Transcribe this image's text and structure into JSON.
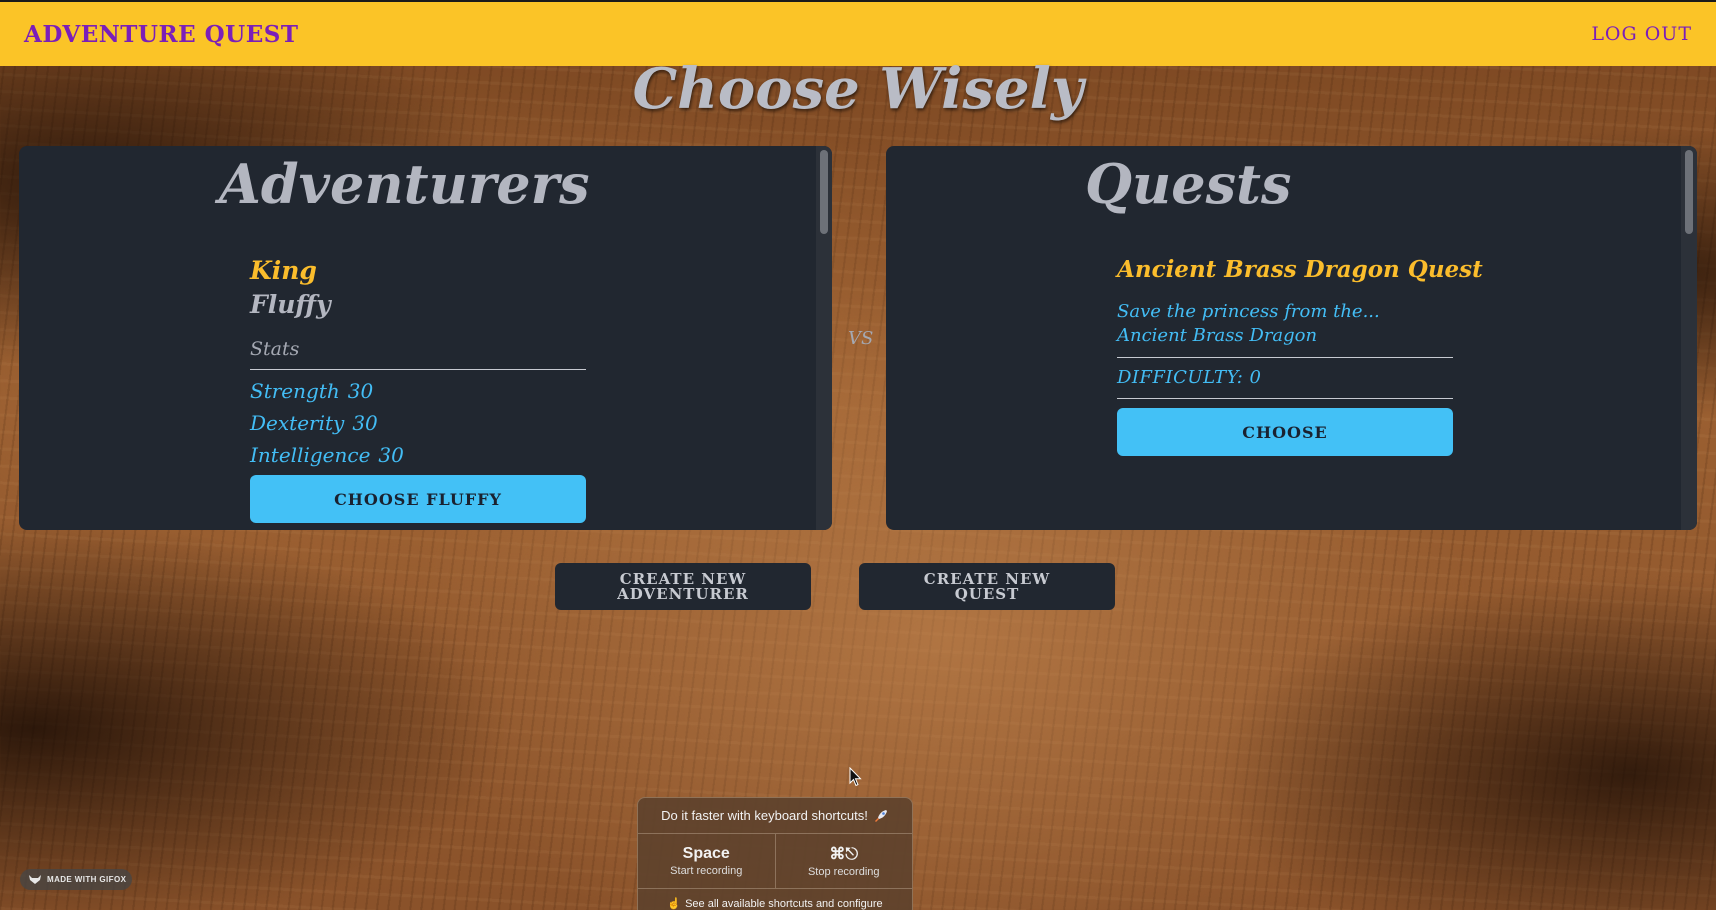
{
  "header": {
    "brand": "ADVENTURE QUEST",
    "logout_label": "LOG OUT"
  },
  "page": {
    "title": "Choose Wisely",
    "vs_label": "VS"
  },
  "adventurers": {
    "title": "Adventurers",
    "items": [
      {
        "class": "King",
        "name": "Fluffy",
        "stats_label": "Stats",
        "stats": [
          {
            "label": "Strength",
            "value": "30"
          },
          {
            "label": "Dexterity",
            "value": "30"
          },
          {
            "label": "Intelligence",
            "value": "30"
          }
        ],
        "button_label": "CHOOSE FLUFFY"
      }
    ]
  },
  "quests": {
    "title": "Quests",
    "items": [
      {
        "title": "Ancient Brass Dragon Quest",
        "description": "Save the princess from the... Ancient Brass Dragon",
        "difficulty": "DIFFICULTY: 0",
        "button_label": "CHOOSE"
      }
    ]
  },
  "actions": {
    "create_adventurer": "CREATE NEW ADVENTURER",
    "create_quest": "CREATE NEW QUEST"
  },
  "gifox": {
    "badge_text": "MADE WITH GIFOX",
    "popup": {
      "header": "Do it faster with keyboard shortcuts!",
      "shortcuts": [
        {
          "key": "Space",
          "action": "Start recording"
        },
        {
          "key": "⌘⎋",
          "action": "Stop recording"
        }
      ],
      "footer": "See all available shortcuts and configure"
    }
  },
  "colors": {
    "header_bg": "#fbc427",
    "brand": "#7b1fb8",
    "panel_bg": "#212730",
    "accent_blue": "#43c1f6",
    "accent_gold": "#fbbd2c"
  }
}
